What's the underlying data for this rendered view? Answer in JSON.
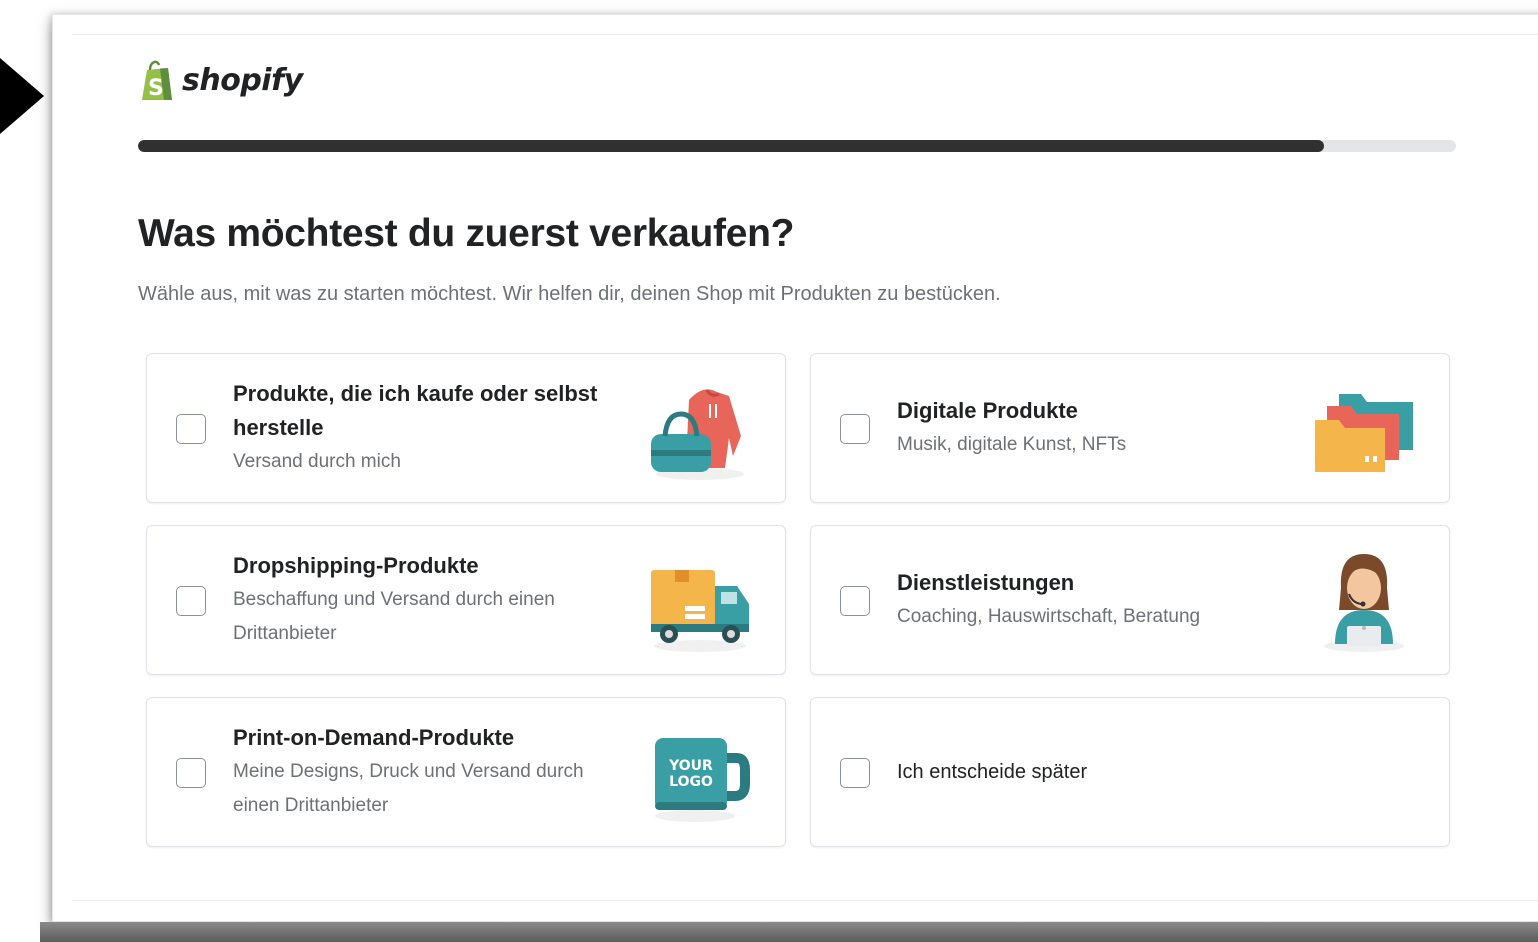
{
  "brand": {
    "name": "shopify"
  },
  "progress": {
    "fraction": 0.9
  },
  "heading": {
    "title": "Was möchtest du zuerst verkaufen?",
    "subtitle": "Wähle aus, mit was zu starten möchtest. Wir helfen dir, deinen Shop mit Produkten zu bestücken."
  },
  "options": [
    {
      "title": "Produkte, die ich kaufe oder selbst herstelle",
      "desc": "Versand durch mich",
      "icon": "clothing-bag-icon",
      "checked": false
    },
    {
      "title": "Digitale Produkte",
      "desc": "Musik, digitale Kunst, NFTs",
      "icon": "folders-icon",
      "checked": false
    },
    {
      "title": "Dropshipping-Produkte",
      "desc": "Beschaffung und Versand durch einen Drittanbieter",
      "icon": "delivery-truck-icon",
      "checked": false
    },
    {
      "title": "Dienstleistungen",
      "desc": "Coaching, Hauswirtschaft, Beratung",
      "icon": "consultant-person-icon",
      "checked": false
    },
    {
      "title": "Print-on-Demand-Produkte",
      "desc": "Meine Designs, Druck und Versand durch einen Drittanbieter",
      "icon": "logo-mug-icon",
      "mug_text": "YOUR LOGO",
      "checked": false
    },
    {
      "title": "Ich entscheide später",
      "desc": "",
      "icon": "",
      "checked": false
    }
  ],
  "colors": {
    "brand_green": "#95bf47",
    "progress_fill": "#303030",
    "progress_track": "#e4e5e7",
    "teal": "#3a9ea5",
    "coral": "#e8655a",
    "orange": "#f4b54a"
  }
}
